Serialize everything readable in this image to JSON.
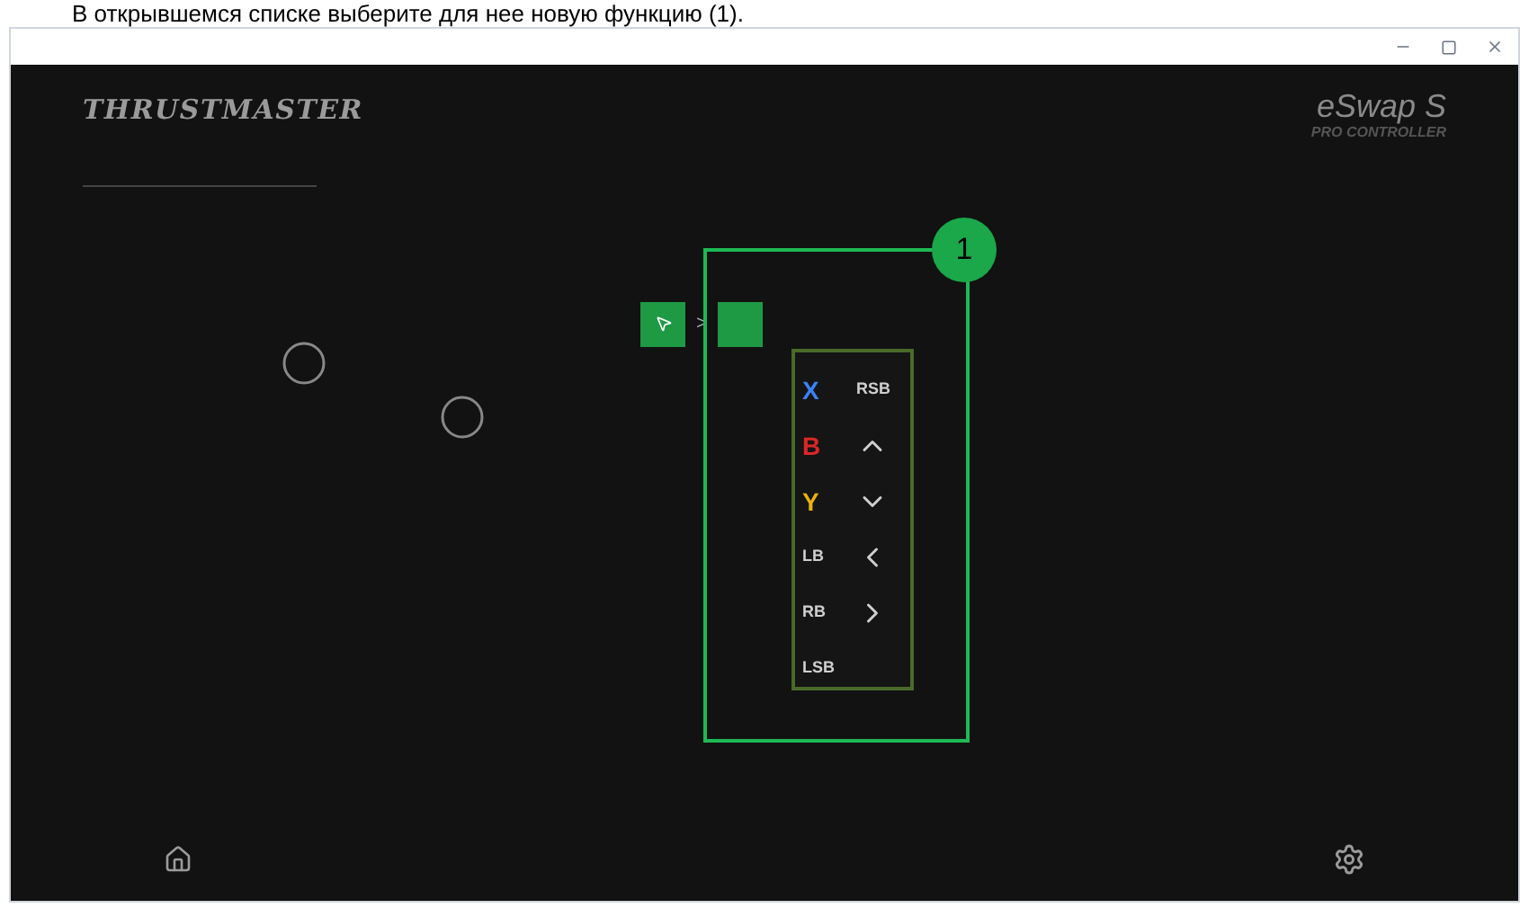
{
  "caption": "В открывшемся списке выберите для нее новую функцию (1).",
  "app": {
    "brand": "THRUSTMASTER",
    "product": "eSwap S",
    "product_sub": "PRO CONTROLLER"
  },
  "mapping": {
    "arrow": ">"
  },
  "menu": {
    "items": [
      {
        "kind": "text",
        "label": "X",
        "color": "#3b82f6"
      },
      {
        "kind": "text",
        "label": "RSB"
      },
      {
        "kind": "text",
        "label": "B",
        "color": "#dc2626"
      },
      {
        "kind": "up"
      },
      {
        "kind": "text",
        "label": "Y",
        "color": "#eab308"
      },
      {
        "kind": "down"
      },
      {
        "kind": "text",
        "label": "LB"
      },
      {
        "kind": "left"
      },
      {
        "kind": "text",
        "label": "RB"
      },
      {
        "kind": "right"
      },
      {
        "kind": "text",
        "label": "LSB"
      }
    ]
  },
  "callout": {
    "number": "1"
  }
}
